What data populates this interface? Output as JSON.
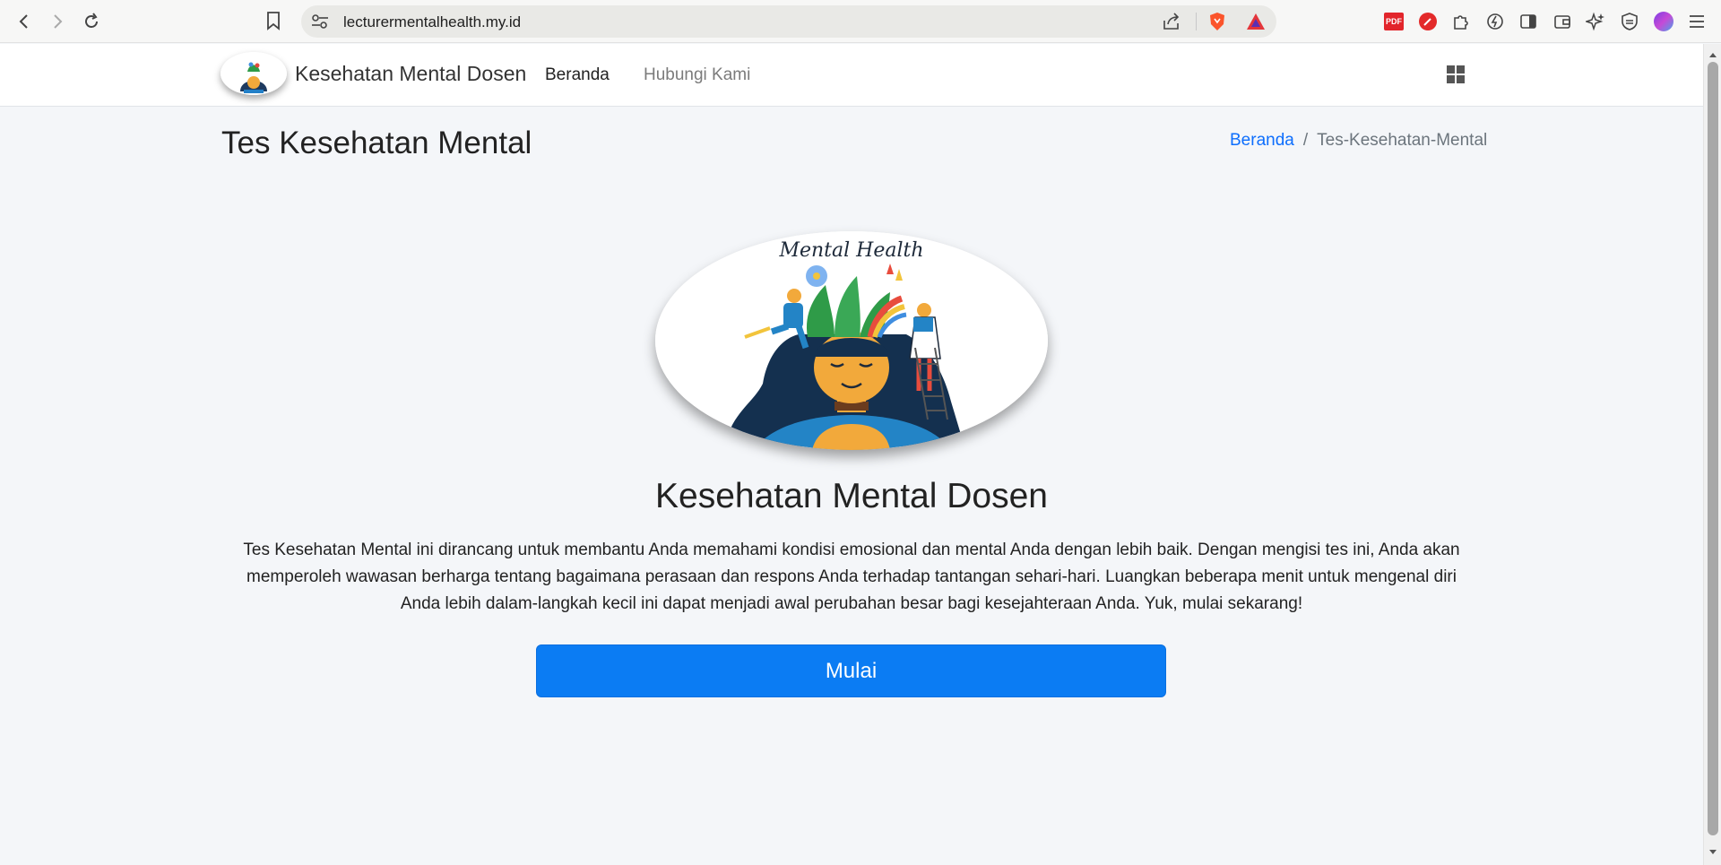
{
  "browser": {
    "url": "lecturermentalhealth.my.id"
  },
  "navbar": {
    "brand": "Kesehatan Mental Dosen",
    "items": [
      {
        "label": "Beranda"
      },
      {
        "label": "Hubungi Kami"
      }
    ]
  },
  "header": {
    "title": "Tes Kesehatan Mental",
    "breadcrumb": [
      "Beranda",
      "Tes-Kesehatan-Mental"
    ],
    "breadcrumb_sep": "/"
  },
  "hero": {
    "image_caption": "Mental Health",
    "title": "Kesehatan Mental Dosen",
    "description": "Tes Kesehatan Mental ini dirancang untuk membantu Anda memahami kondisi emosional dan mental Anda dengan lebih baik. Dengan mengisi tes ini, Anda akan memperoleh wawasan berharga tentang bagaimana perasaan dan respons Anda terhadap tantangan sehari-hari. Luangkan beberapa menit untuk mengenal diri Anda lebih dalam-langkah kecil ini dapat menjadi awal perubahan besar bagi kesejahteraan Anda. Yuk, mulai sekarang!",
    "button_label": "Mulai"
  },
  "icons": {
    "pdf": "PDF"
  },
  "colors": {
    "primary": "#0b7cf3",
    "link": "#0d6efd"
  }
}
